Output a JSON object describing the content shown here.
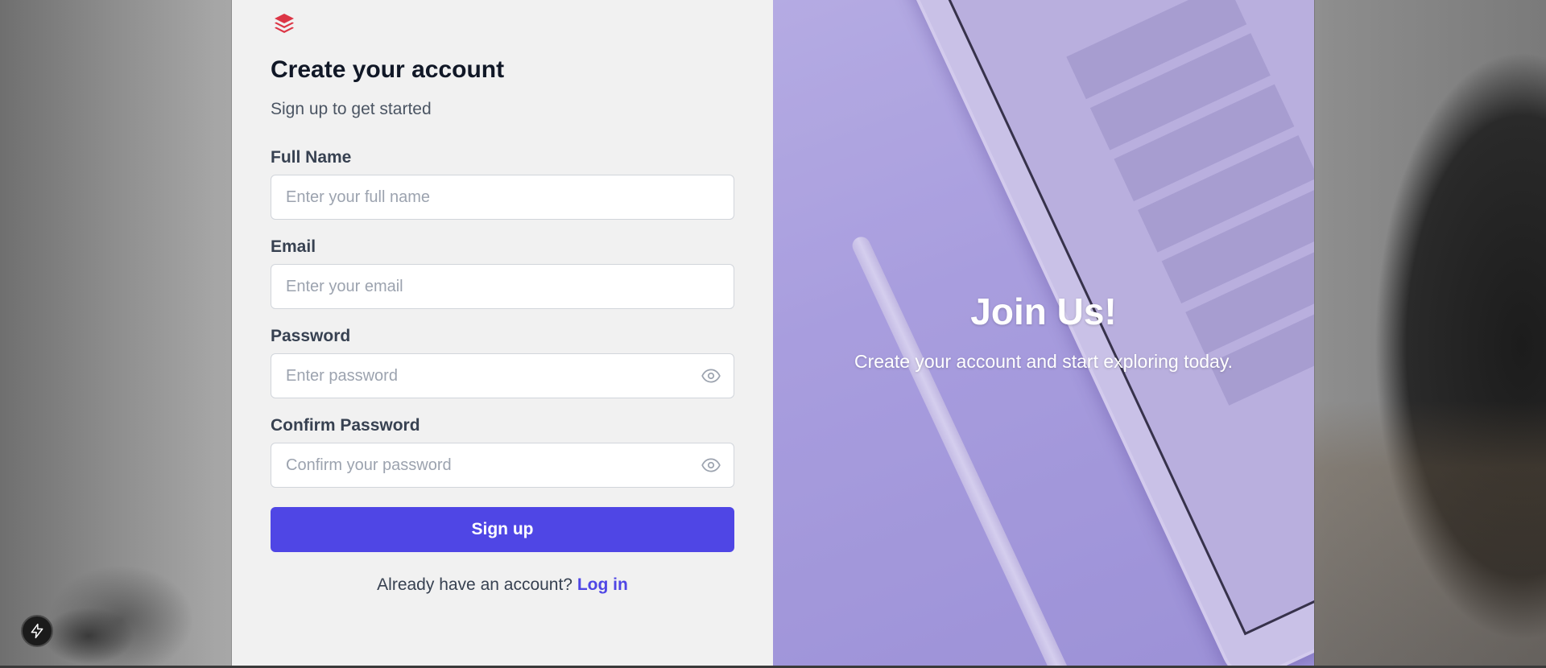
{
  "form": {
    "title": "Create your account",
    "subtitle": "Sign up to get started",
    "fields": [
      {
        "label": "Full Name",
        "placeholder": "Enter your full name",
        "value": ""
      },
      {
        "label": "Email",
        "placeholder": "Enter your email",
        "value": ""
      },
      {
        "label": "Password",
        "placeholder": "Enter password",
        "value": ""
      },
      {
        "label": "Confirm Password",
        "placeholder": "Confirm your password",
        "value": ""
      }
    ],
    "submit_label": "Sign up",
    "login_prompt": "Already have an account?",
    "login_link": "Log in"
  },
  "hero": {
    "title": "Join Us!",
    "subtitle": "Create your account and start exploring today."
  },
  "icons": {
    "logo": "layers-logo-icon",
    "password_toggle": "eye-icon",
    "dev_tools": "lightning-bolt-icon"
  },
  "colors": {
    "accent": "#4f46e5",
    "logo": "#dc3545",
    "form_bg": "#f4f4f4",
    "heading": "#111827",
    "muted": "#4b5563",
    "placeholder": "#9ca3af"
  }
}
